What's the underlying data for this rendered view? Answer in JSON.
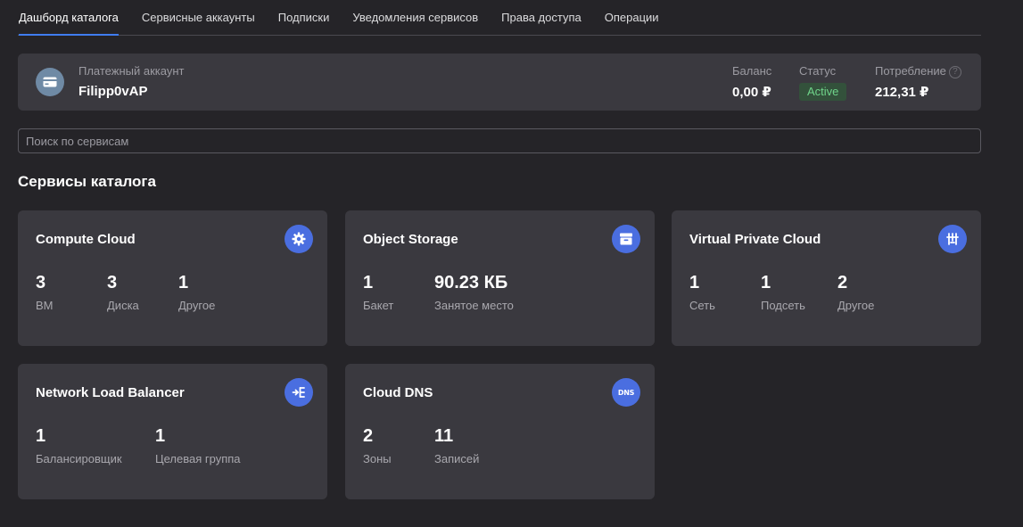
{
  "tabs": [
    {
      "label": "Дашборд каталога",
      "active": true
    },
    {
      "label": "Сервисные аккаунты",
      "active": false
    },
    {
      "label": "Подписки",
      "active": false
    },
    {
      "label": "Уведомления сервисов",
      "active": false
    },
    {
      "label": "Права доступа",
      "active": false
    },
    {
      "label": "Операции",
      "active": false
    }
  ],
  "billing": {
    "account_label": "Платежный аккаунт",
    "account_name": "Filipp0vAP",
    "balance_label": "Баланс",
    "balance_value": "0,00 ₽",
    "status_label": "Статус",
    "status_value": "Active",
    "consumption_label": "Потребление",
    "consumption_help": "?",
    "consumption_value": "212,31 ₽"
  },
  "search": {
    "placeholder": "Поиск по сервисам",
    "value": ""
  },
  "section_title": "Сервисы каталога",
  "cards": [
    {
      "title": "Compute Cloud",
      "icon": "gear-icon",
      "metrics": [
        {
          "value": "3",
          "label": "ВМ"
        },
        {
          "value": "3",
          "label": "Диска"
        },
        {
          "value": "1",
          "label": "Другое"
        }
      ]
    },
    {
      "title": "Object Storage",
      "icon": "storage-box-icon",
      "metrics": [
        {
          "value": "1",
          "label": "Бакет"
        },
        {
          "value": "90.23 КБ",
          "label": "Занятое место"
        }
      ]
    },
    {
      "title": "Virtual Private Cloud",
      "icon": "network-icon",
      "metrics": [
        {
          "value": "1",
          "label": "Сеть"
        },
        {
          "value": "1",
          "label": "Подсеть"
        },
        {
          "value": "2",
          "label": "Другое"
        }
      ]
    },
    {
      "title": "Network Load Balancer",
      "icon": "load-balancer-icon",
      "metrics": [
        {
          "value": "1",
          "label": "Балансировщик"
        },
        {
          "value": "1",
          "label": "Целевая группа"
        }
      ]
    },
    {
      "title": "Cloud DNS",
      "icon": "dns-icon",
      "icon_text": "DNS",
      "metrics": [
        {
          "value": "2",
          "label": "Зоны"
        },
        {
          "value": "11",
          "label": "Записей"
        }
      ]
    }
  ],
  "colors": {
    "accent": "#3f7cf0",
    "icon_bg": "#4a6ee0",
    "card_bg": "#3a393f",
    "page_bg": "#252428",
    "status_green": "#6fd48a"
  }
}
